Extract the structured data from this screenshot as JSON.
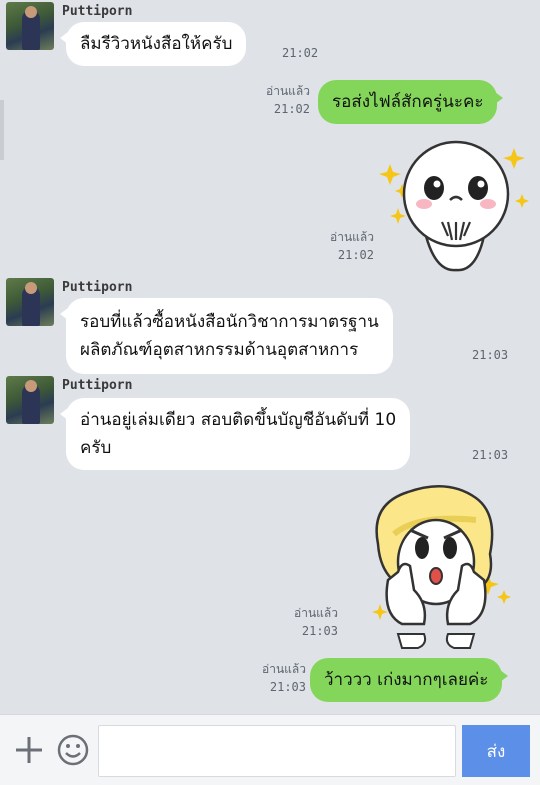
{
  "sender_name": "Puttiporn",
  "read_label": "อ่านแล้ว",
  "messages": [
    {
      "text": "ลืมรีวิวหนังสือให้ครับ",
      "time": "21:02"
    },
    {
      "text": "รอส่งไฟล์สักครู่นะคะ",
      "time": "21:02"
    },
    {
      "text": "",
      "time": "21:02"
    },
    {
      "line1": "รอบที่แล้วซื้อหนังสือนักวิชาการมาตรฐาน",
      "line2": "ผลิตภัณฑ์อุตสาหกรรมด้านอุตสาหการ",
      "time": "21:03"
    },
    {
      "line1": "อ่านอยู่เล่มเดียว สอบติดขึ้นบัญชีอันดับที่ 10",
      "line2": "ครับ",
      "time": "21:03"
    },
    {
      "text": "",
      "time": "21:03"
    },
    {
      "text": "ว้าววว เก่งมากๆเลยค่ะ",
      "time": "21:03"
    }
  ],
  "composer": {
    "input_value": "",
    "send_label": "ส่ง"
  },
  "colors": {
    "background": "#dfe3e8",
    "outgoing_bubble": "#84d65a",
    "incoming_bubble": "#ffffff",
    "send_button": "#5b8fe8"
  },
  "icons": [
    "plus-icon",
    "emoji-icon"
  ]
}
